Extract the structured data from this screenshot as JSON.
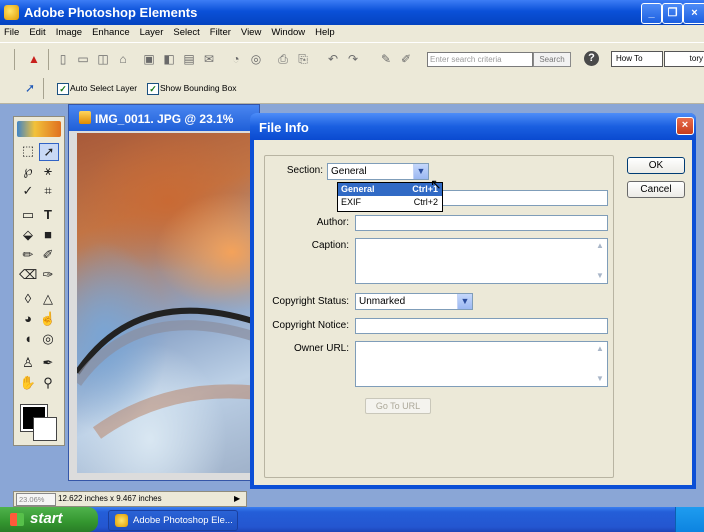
{
  "app": {
    "title": "Adobe Photoshop Elements",
    "window_buttons": [
      "_",
      "❐",
      "×"
    ]
  },
  "menu": [
    "File",
    "Edit",
    "Image",
    "Enhance",
    "Layer",
    "Select",
    "Filter",
    "View",
    "Window",
    "Help"
  ],
  "shortcuts": {
    "icons": [
      "acrobat-icon",
      "new-icon",
      "open-icon",
      "browse-icon",
      "save-icon",
      "save-web-icon",
      "print-icon",
      "print-preview-icon",
      "email-icon",
      "step-backward-icon",
      "step-forward-icon",
      "fix-icon",
      "quick-fix-icon",
      "online-services-icon",
      "undo-icon",
      "redo-icon"
    ],
    "search_placeholder": "Enter search criteria",
    "search_button": "Search",
    "help_glyph": "?",
    "palette_tabs": [
      "How To",
      "tory"
    ]
  },
  "options_bar": {
    "auto_select_layer": "Auto Select Layer",
    "show_bounding_box": "Show Bounding Box"
  },
  "document": {
    "title": "IMG_0011. JPG @ 23.1%"
  },
  "status_bar": {
    "zoom": "23.06%",
    "size": "12.622 inches x 9.467 inches",
    "arrow": "▶"
  },
  "taskbar": {
    "start": "start",
    "task": "Adobe Photoshop Ele..."
  },
  "dialog": {
    "title": "File Info",
    "close_glyph": "×",
    "section_label": "Section:",
    "section_value": "General",
    "section_options": [
      {
        "label": "General",
        "shortcut": "Ctrl+1"
      },
      {
        "label": "EXIF",
        "shortcut": "Ctrl+2"
      }
    ],
    "author_label": "Author:",
    "caption_label": "Caption:",
    "copyright_status_label": "Copyright Status:",
    "copyright_status_value": "Unmarked",
    "copyright_notice_label": "Copyright Notice:",
    "owner_url_label": "Owner URL:",
    "go_to_url": "Go To URL",
    "ok": "OK",
    "cancel": "Cancel"
  },
  "colors": {
    "xp_blue": "#0a50d8",
    "panel": "#ece9d8",
    "selection": "#316ac5"
  }
}
